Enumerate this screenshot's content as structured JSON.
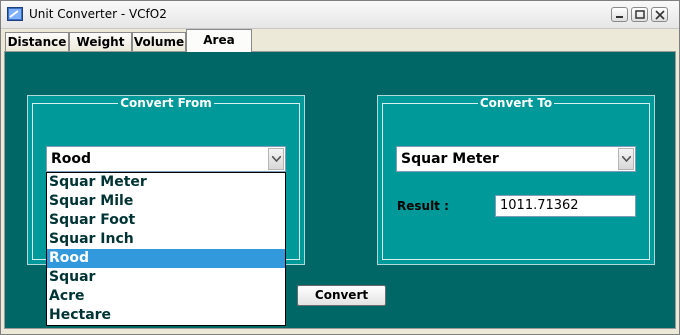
{
  "window": {
    "title": "Unit Converter - VCfO2",
    "controls": [
      "minimize",
      "maximize",
      "close"
    ]
  },
  "tabs": [
    {
      "label": "Distance",
      "active": false
    },
    {
      "label": "Weight",
      "active": false
    },
    {
      "label": "Volume",
      "active": false
    },
    {
      "label": "Area",
      "active": true
    }
  ],
  "convert_from": {
    "legend": "Convert From",
    "selected": "Rood",
    "dropdown_open": true,
    "options": [
      "Squar Meter",
      "Squar Mile",
      "Squar Foot",
      "Squar Inch",
      "Rood",
      "Squar",
      "Acre",
      "Hectare"
    ],
    "highlighted_index": 4
  },
  "convert_to": {
    "legend": "Convert To",
    "selected": "Squar Meter",
    "result_label": "Result :",
    "result_value": "1011.71362"
  },
  "convert_button": {
    "label": "Convert"
  },
  "colors": {
    "background": "#006666",
    "panel": "#009999",
    "highlight": "#3399dd"
  }
}
